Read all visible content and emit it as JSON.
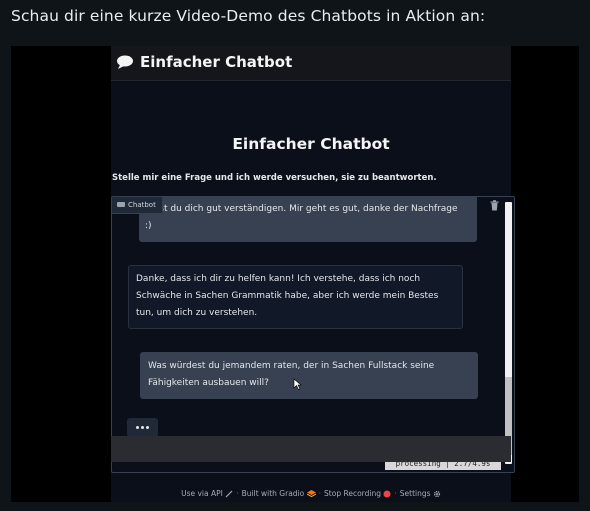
{
  "caption": "Schau dir eine kurze Video-Demo des Chatbots in Aktion an:",
  "app": {
    "header_title": "Einfacher Chatbot",
    "page_title": "Einfacher Chatbot",
    "subtitle": "Stelle mir eine Frage und ich werde versuchen, sie zu beantworten."
  },
  "chat": {
    "label": "Chatbot",
    "messages": [
      {
        "role": "user",
        "lines": [
          "...nst du dich gut verständigen. Mir geht es gut, danke der Nachfrage",
          ":)"
        ]
      },
      {
        "role": "bot",
        "lines": [
          "Danke, dass ich dir zu helfen kann! Ich verstehe, dass ich noch",
          "Schwäche in Sachen Grammatik habe, aber ich werde mein Bestes",
          "tun, um dich zu verstehen."
        ]
      },
      {
        "role": "user",
        "lines": [
          "Was würdest du jemandem raten, der in Sachen Fullstack seine",
          "Fähigkeiten ausbauen will?"
        ]
      }
    ],
    "typing_indicator": "•••",
    "status": "processing | 2.7/4.9s"
  },
  "footer": {
    "api": "Use via API",
    "built": "Built with Gradio",
    "record": "Stop Recording",
    "settings": "Settings",
    "separator": "·"
  },
  "icons": {
    "header": "speech-bubble-icon",
    "chat_label": "chat-icon",
    "clear": "trash-icon",
    "api": "rocket-icon",
    "gradio": "gradio-logo-icon",
    "record": "record-icon",
    "settings": "gear-icon"
  },
  "colors": {
    "background": "#0f1419",
    "app_background": "#0b0f19",
    "user_bubble": "#374151",
    "bot_bubble": "#111827",
    "record_red": "#ef4444",
    "gradio_orange": "#f97316"
  }
}
